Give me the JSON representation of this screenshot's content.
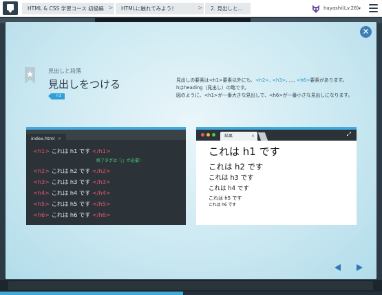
{
  "header": {
    "breadcrumbs": [
      "HTML & CSS 学習コース 初級編",
      "HTMLに触れてみよう！",
      "2. 見出しと..."
    ],
    "separator": ">",
    "username": "hayashi(Lv.28)",
    "menu_caret": "▾"
  },
  "lesson": {
    "close_glyph": "✕",
    "subtitle": "見出しと段落",
    "title": "見出しをつける",
    "tag": "h1",
    "description_lines": [
      {
        "parts": [
          {
            "t": "見出しの要素は<h1>要素以外にも、",
            "c": ""
          },
          {
            "t": "<h2>",
            "c": "hl"
          },
          {
            "t": ", ",
            "c": ""
          },
          {
            "t": "<h3>",
            "c": "hl"
          },
          {
            "t": ", ..., ",
            "c": ""
          },
          {
            "t": "<h6>",
            "c": "hl"
          },
          {
            "t": "要素があります。",
            "c": ""
          }
        ]
      },
      {
        "parts": [
          {
            "t": "hはheading（見出し）の略です。",
            "c": ""
          }
        ]
      },
      {
        "parts": [
          {
            "t": "図のように、<h1>が一番大きな見出しで、<h6>が一番小さな見出しになります。",
            "c": ""
          }
        ]
      }
    ]
  },
  "editor": {
    "tab_label": "index.html",
    "tab_close": "×",
    "lines": [
      {
        "open": "<h1>",
        "text": " これは h1 です ",
        "close": "</h1>"
      },
      {
        "open": "<h2>",
        "text": " これは h2 です ",
        "close": "</h2>"
      },
      {
        "open": "<h3>",
        "text": " これは h3 です ",
        "close": "</h3>"
      },
      {
        "open": "<h4>",
        "text": " これは h4 です ",
        "close": "</h4>"
      },
      {
        "open": "<h5>",
        "text": " これは h5 です ",
        "close": "</h5>"
      },
      {
        "open": "<h6>",
        "text": " これは h6 です ",
        "close": "</h6>"
      }
    ],
    "note": "終了タグは「/」が必要！"
  },
  "browser": {
    "tab_label": "結果",
    "tab_close": "×",
    "expand_glyph": "⤢",
    "headings": [
      {
        "text": "これは h1 です",
        "size": 15
      },
      {
        "text": "これは h2 です",
        "size": 11.5
      },
      {
        "text": "これは h3 です",
        "size": 9.5
      },
      {
        "text": "これは h4 です",
        "size": 8.5
      },
      {
        "text": "これは h5 です",
        "size": 7
      },
      {
        "text": "これは h6 です",
        "size": 5.8
      }
    ],
    "dot_colors": [
      "#ea5a5a",
      "#f2b33d",
      "#55c258"
    ]
  },
  "progress": {
    "fraction": 0.48
  },
  "colors": {
    "accent": "#41a9de",
    "tag_color": "#e05270",
    "note_color": "#49d17b"
  }
}
